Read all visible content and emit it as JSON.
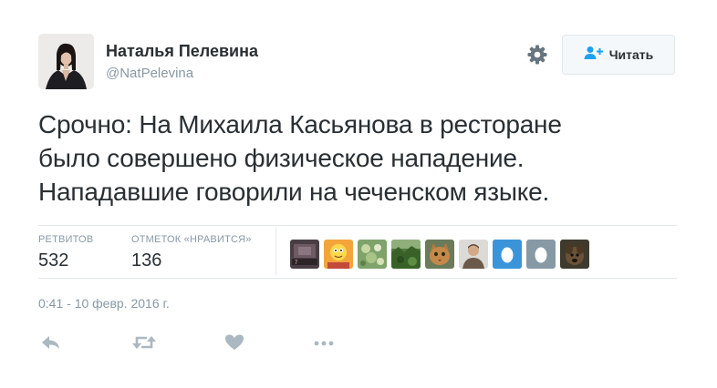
{
  "author": {
    "name": "Наталья Пелевина",
    "handle": "@NatPelevina"
  },
  "follow_button": {
    "label": "Читать",
    "icon": "add-user-icon"
  },
  "settings_icon": "gear-icon",
  "tweet": {
    "lines": [
      "Срочно: На Михаила Касьянова в ресторане",
      "было совершено физическое нападение.",
      "Нападавшие говорили на чеченском языке."
    ]
  },
  "stats": {
    "retweets_label": "РЕТВИТОВ",
    "retweets_value": "532",
    "likes_label": "ОТМЕТОК «НРАВИТСЯ»",
    "likes_value": "136"
  },
  "likers": [
    {
      "icon": "avatar-photo",
      "badge": "7"
    },
    {
      "icon": "avatar-cartoon"
    },
    {
      "icon": "avatar-flowers"
    },
    {
      "icon": "avatar-greenery"
    },
    {
      "icon": "avatar-cat"
    },
    {
      "icon": "avatar-person"
    },
    {
      "icon": "avatar-default-egg"
    },
    {
      "icon": "avatar-default-egg"
    },
    {
      "icon": "avatar-dog"
    }
  ],
  "timestamp": "0:41 - 10 февр. 2016 г.",
  "actions": [
    "reply-icon",
    "retweet-icon",
    "heart-icon",
    "more-icon"
  ],
  "colors": {
    "text": "#292f33",
    "muted": "#8899a6",
    "divider": "#e1e8ed",
    "egg_blue": "#3b94d9",
    "egg_gray": "#8899a6",
    "follow_icon": "#1da1f2"
  }
}
